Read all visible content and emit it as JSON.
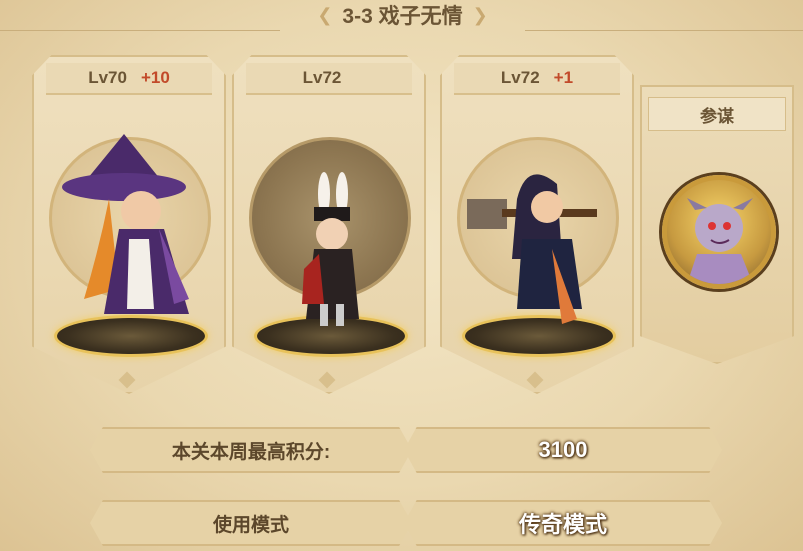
{
  "title": {
    "text": "3-3 戏子无情",
    "left_ornament": "❮",
    "right_ornament": "❯"
  },
  "heroes": [
    {
      "level": "Lv70",
      "bonus": "+10",
      "pedestal_style": "light"
    },
    {
      "level": "Lv72",
      "bonus": "",
      "pedestal_style": "dark"
    },
    {
      "level": "Lv72",
      "bonus": "+1",
      "pedestal_style": "light"
    }
  ],
  "strategist": {
    "label": "参谋"
  },
  "score": {
    "label": "本关本周最高积分:",
    "value": "3100"
  },
  "buttons": {
    "normal_mode": "使用模式",
    "legend_mode": "传奇模式"
  },
  "colors": {
    "accent_text": "#6b5535",
    "bonus_red": "#c24a2a",
    "gold_ring": "#e8c25a"
  }
}
